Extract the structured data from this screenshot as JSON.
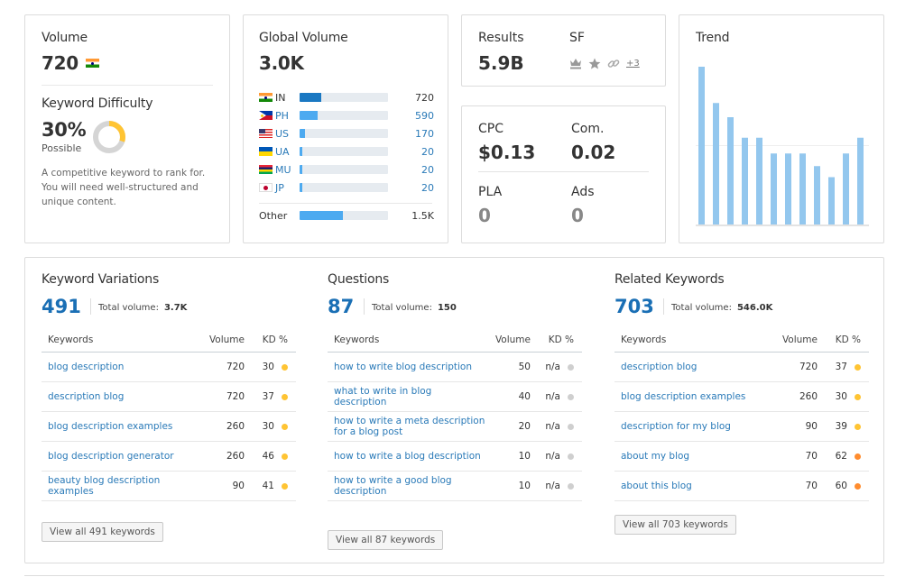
{
  "volume": {
    "title": "Volume",
    "value": "720",
    "country_flag": "IN",
    "kd_title": "Keyword Difficulty",
    "kd_value": "30%",
    "kd_percent": 30,
    "kd_label": "Possible",
    "kd_color": "#ffc433",
    "description": "A competitive keyword to rank for. You will need well-structured and unique content."
  },
  "global_volume": {
    "title": "Global Volume",
    "value": "3.0K",
    "countries": [
      {
        "code": "IN",
        "flag": "in",
        "value": "720",
        "share": 0.24
      },
      {
        "code": "PH",
        "flag": "ph",
        "value": "590",
        "share": 0.2
      },
      {
        "code": "US",
        "flag": "us",
        "value": "170",
        "share": 0.06
      },
      {
        "code": "UA",
        "flag": "ua",
        "value": "20",
        "share": 0.02
      },
      {
        "code": "MU",
        "flag": "mu",
        "value": "20",
        "share": 0.02
      },
      {
        "code": "JP",
        "flag": "jp",
        "value": "20",
        "share": 0.02
      }
    ],
    "other": {
      "label": "Other",
      "value": "1.5K",
      "share": 0.49
    }
  },
  "results": {
    "label": "Results",
    "value": "5.9B",
    "sf_label": "SF",
    "sf_icons": [
      "crown-icon",
      "star-icon",
      "link-icon"
    ],
    "sf_more": "+3"
  },
  "cpc": {
    "cpc_label": "CPC",
    "cpc_value": "$0.13",
    "com_label": "Com.",
    "com_value": "0.02",
    "pla_label": "PLA",
    "pla_value": "0",
    "ads_label": "Ads",
    "ads_value": "0"
  },
  "trend": {
    "title": "Trend",
    "values": [
      1.0,
      0.77,
      0.68,
      0.55,
      0.55,
      0.45,
      0.45,
      0.45,
      0.37,
      0.3,
      0.45,
      0.55
    ],
    "bar_color": "#93c7ee"
  },
  "kd_colors": {
    "yellow": "#ffc433",
    "orange": "#ff8c2e",
    "grey": "#cfcfcf"
  },
  "sections": [
    {
      "id": "variations",
      "title": "Keyword Variations",
      "count": "491",
      "total_label": "Total volume:",
      "total_value": "3.7K",
      "headers": {
        "keyword": "Keywords",
        "volume": "Volume",
        "kd": "KD %"
      },
      "rows": [
        {
          "keyword": "blog description",
          "volume": "720",
          "kd": "30",
          "kd_level": "yellow"
        },
        {
          "keyword": "description blog",
          "volume": "720",
          "kd": "37",
          "kd_level": "yellow"
        },
        {
          "keyword": "blog description examples",
          "volume": "260",
          "kd": "30",
          "kd_level": "yellow"
        },
        {
          "keyword": "blog description generator",
          "volume": "260",
          "kd": "46",
          "kd_level": "yellow"
        },
        {
          "keyword": "beauty blog description examples",
          "volume": "90",
          "kd": "41",
          "kd_level": "yellow"
        }
      ],
      "button": "View all 491 keywords"
    },
    {
      "id": "questions",
      "title": "Questions",
      "count": "87",
      "total_label": "Total volume:",
      "total_value": "150",
      "headers": {
        "keyword": "Keywords",
        "volume": "Volume",
        "kd": "KD %"
      },
      "rows": [
        {
          "keyword": "how to write blog description",
          "volume": "50",
          "kd": "n/a",
          "kd_level": "grey"
        },
        {
          "keyword": "what to write in blog description",
          "volume": "40",
          "kd": "n/a",
          "kd_level": "grey"
        },
        {
          "keyword": "how to write a meta description for a blog post",
          "volume": "20",
          "kd": "n/a",
          "kd_level": "grey"
        },
        {
          "keyword": "how to write a blog description",
          "volume": "10",
          "kd": "n/a",
          "kd_level": "grey"
        },
        {
          "keyword": "how to write a good blog description",
          "volume": "10",
          "kd": "n/a",
          "kd_level": "grey"
        }
      ],
      "button": "View all 87 keywords"
    },
    {
      "id": "related",
      "title": "Related Keywords",
      "count": "703",
      "total_label": "Total volume:",
      "total_value": "546.0K",
      "headers": {
        "keyword": "Keywords",
        "volume": "Volume",
        "kd": "KD %"
      },
      "rows": [
        {
          "keyword": "description blog",
          "volume": "720",
          "kd": "37",
          "kd_level": "yellow"
        },
        {
          "keyword": "blog description examples",
          "volume": "260",
          "kd": "30",
          "kd_level": "yellow"
        },
        {
          "keyword": "description for my blog",
          "volume": "90",
          "kd": "39",
          "kd_level": "yellow"
        },
        {
          "keyword": "about my blog",
          "volume": "70",
          "kd": "62",
          "kd_level": "orange"
        },
        {
          "keyword": "about this blog",
          "volume": "70",
          "kd": "60",
          "kd_level": "orange"
        }
      ],
      "button": "View all 703 keywords"
    }
  ]
}
